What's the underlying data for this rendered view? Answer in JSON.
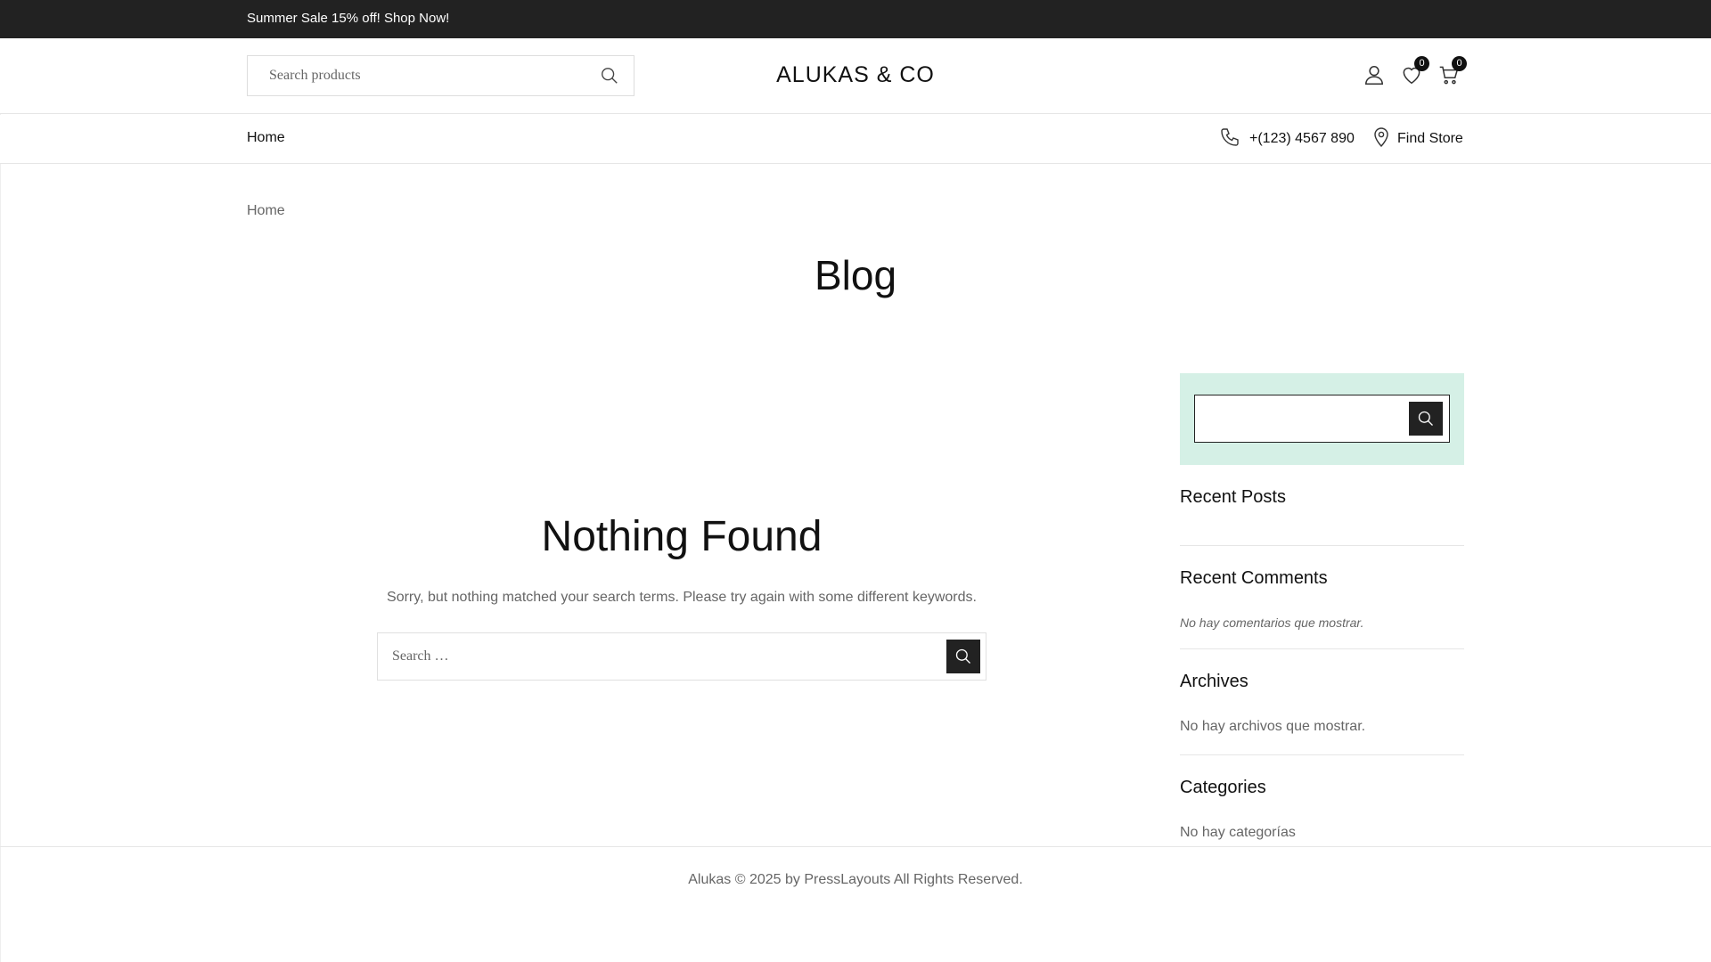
{
  "topbar": {
    "promo": "Summer Sale 15% off! Shop Now!"
  },
  "header": {
    "search_placeholder": "Search products",
    "logo": "ALUKAS & CO",
    "wishlist_count": "0",
    "cart_count": "0"
  },
  "nav": {
    "home": "Home",
    "phone": "+(123) 4567 890",
    "store": "Find Store"
  },
  "breadcrumb": "Home",
  "page_title": "Blog",
  "content": {
    "title": "Nothing Found",
    "message": "Sorry, but nothing matched your search terms. Please try again with some different keywords.",
    "search_placeholder": "Search …"
  },
  "sidebar": {
    "search_value": "",
    "recent_posts_title": "Recent Posts",
    "recent_comments_title": "Recent Comments",
    "recent_comments_empty": "No hay comentarios que mostrar.",
    "archives_title": "Archives",
    "archives_empty": "No hay archivos que mostrar.",
    "categories_title": "Categories",
    "categories_empty": "No hay categorías"
  },
  "footer": {
    "copyright": "Alukas © 2025 by PressLayouts All Rights Reserved."
  },
  "colors": {
    "topbar_bg": "#222222",
    "sidebar_search_bg": "#d5f0e6",
    "button_bg": "#222222"
  }
}
